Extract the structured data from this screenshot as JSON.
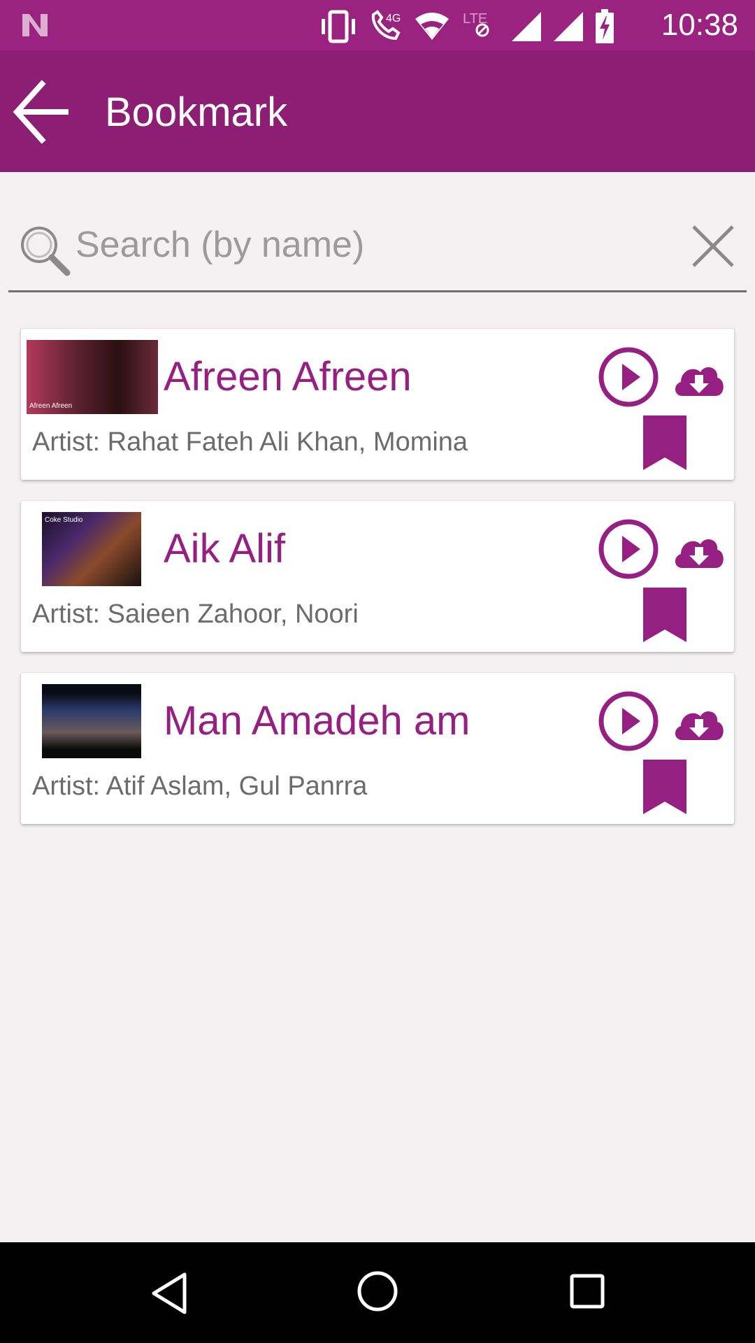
{
  "status_bar": {
    "time": "10:38",
    "network_label": "4G",
    "lte_label": "LTE",
    "icons": [
      "notification-n-icon",
      "vibrate-icon",
      "wifi-call-icon",
      "wifi-icon",
      "lte-icon",
      "signal-icon",
      "signal-icon",
      "battery-charging-icon"
    ]
  },
  "app_bar": {
    "title": "Bookmark",
    "back_icon": "arrow-back-icon"
  },
  "search": {
    "placeholder": "Search (by name)",
    "value": "",
    "search_icon": "search-icon",
    "clear_icon": "close-icon"
  },
  "songs": [
    {
      "title": "Afreen Afreen",
      "artist": "Artist: Rahat Fateh Ali Khan, Momina",
      "thumb_caption": "Afreen Afreen"
    },
    {
      "title": "Aik Alif",
      "artist": "Artist: Saieen Zahoor, Noori",
      "thumb_caption": "Coke Studio"
    },
    {
      "title": "Man Amadeh am",
      "artist": "Artist: Atif Aslam, Gul Panrra",
      "thumb_caption": ""
    }
  ],
  "colors": {
    "status_bar": "#99237f",
    "app_bar": "#8c1f74",
    "accent": "#952082",
    "background": "#f4f1f2",
    "nav_bar": "#000000"
  },
  "nav_bar": {
    "icons": [
      "nav-back-icon",
      "nav-home-icon",
      "nav-recent-icon"
    ]
  }
}
